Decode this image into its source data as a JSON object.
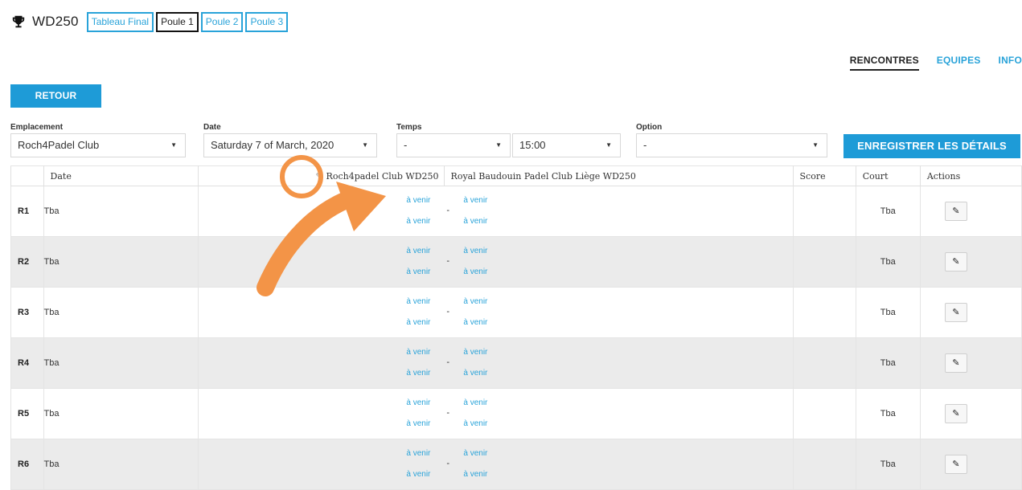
{
  "header": {
    "title": "WD250",
    "tabs": [
      {
        "label": "Tableau Final",
        "active": false
      },
      {
        "label": "Poule 1",
        "active": true
      },
      {
        "label": "Poule 2",
        "active": false
      },
      {
        "label": "Poule 3",
        "active": false
      }
    ],
    "icon": "trophy-icon"
  },
  "nav": {
    "rencontres": "RENCONTRES",
    "equipes": "EQUIPES",
    "info": "INFO"
  },
  "retour_label": "RETOUR",
  "form": {
    "emplacement": {
      "label": "Emplacement",
      "value": "Roch4Padel Club"
    },
    "date": {
      "label": "Date",
      "value": "Saturday 7 of March, 2020"
    },
    "temps": {
      "label": "Temps",
      "value": "-",
      "time": "15:00"
    },
    "option": {
      "label": "Option",
      "value": "-"
    },
    "save_label": "ENREGISTRER LES DÉTAILS"
  },
  "table": {
    "headers": {
      "date": "Date",
      "team1": "Roch4padel Club WD250",
      "team2": "Royal Baudouin Padel Club Liège WD250",
      "score": "Score",
      "court": "Court",
      "actions": "Actions"
    },
    "rows": [
      {
        "round": "R1",
        "date": "Tba",
        "p1": "à venir",
        "p2": "à venir",
        "p3": "à venir",
        "p4": "à venir",
        "sep": "-",
        "court": "Tba"
      },
      {
        "round": "R2",
        "date": "Tba",
        "p1": "à venir",
        "p2": "à venir",
        "p3": "à venir",
        "p4": "à venir",
        "sep": "-",
        "court": "Tba"
      },
      {
        "round": "R3",
        "date": "Tba",
        "p1": "à venir",
        "p2": "à venir",
        "p3": "à venir",
        "p4": "à venir",
        "sep": "-",
        "court": "Tba"
      },
      {
        "round": "R4",
        "date": "Tba",
        "p1": "à venir",
        "p2": "à venir",
        "p3": "à venir",
        "p4": "à venir",
        "sep": "-",
        "court": "Tba"
      },
      {
        "round": "R5",
        "date": "Tba",
        "p1": "à venir",
        "p2": "à venir",
        "p3": "à venir",
        "p4": "à venir",
        "sep": "-",
        "court": "Tba"
      },
      {
        "round": "R6",
        "date": "Tba",
        "p1": "à venir",
        "p2": "à venir",
        "p3": "à venir",
        "p4": "à venir",
        "sep": "-",
        "court": "Tba"
      }
    ]
  },
  "colors": {
    "accent": "#1e9bd7",
    "link": "#29a3d9",
    "annotation": "#f39447"
  }
}
